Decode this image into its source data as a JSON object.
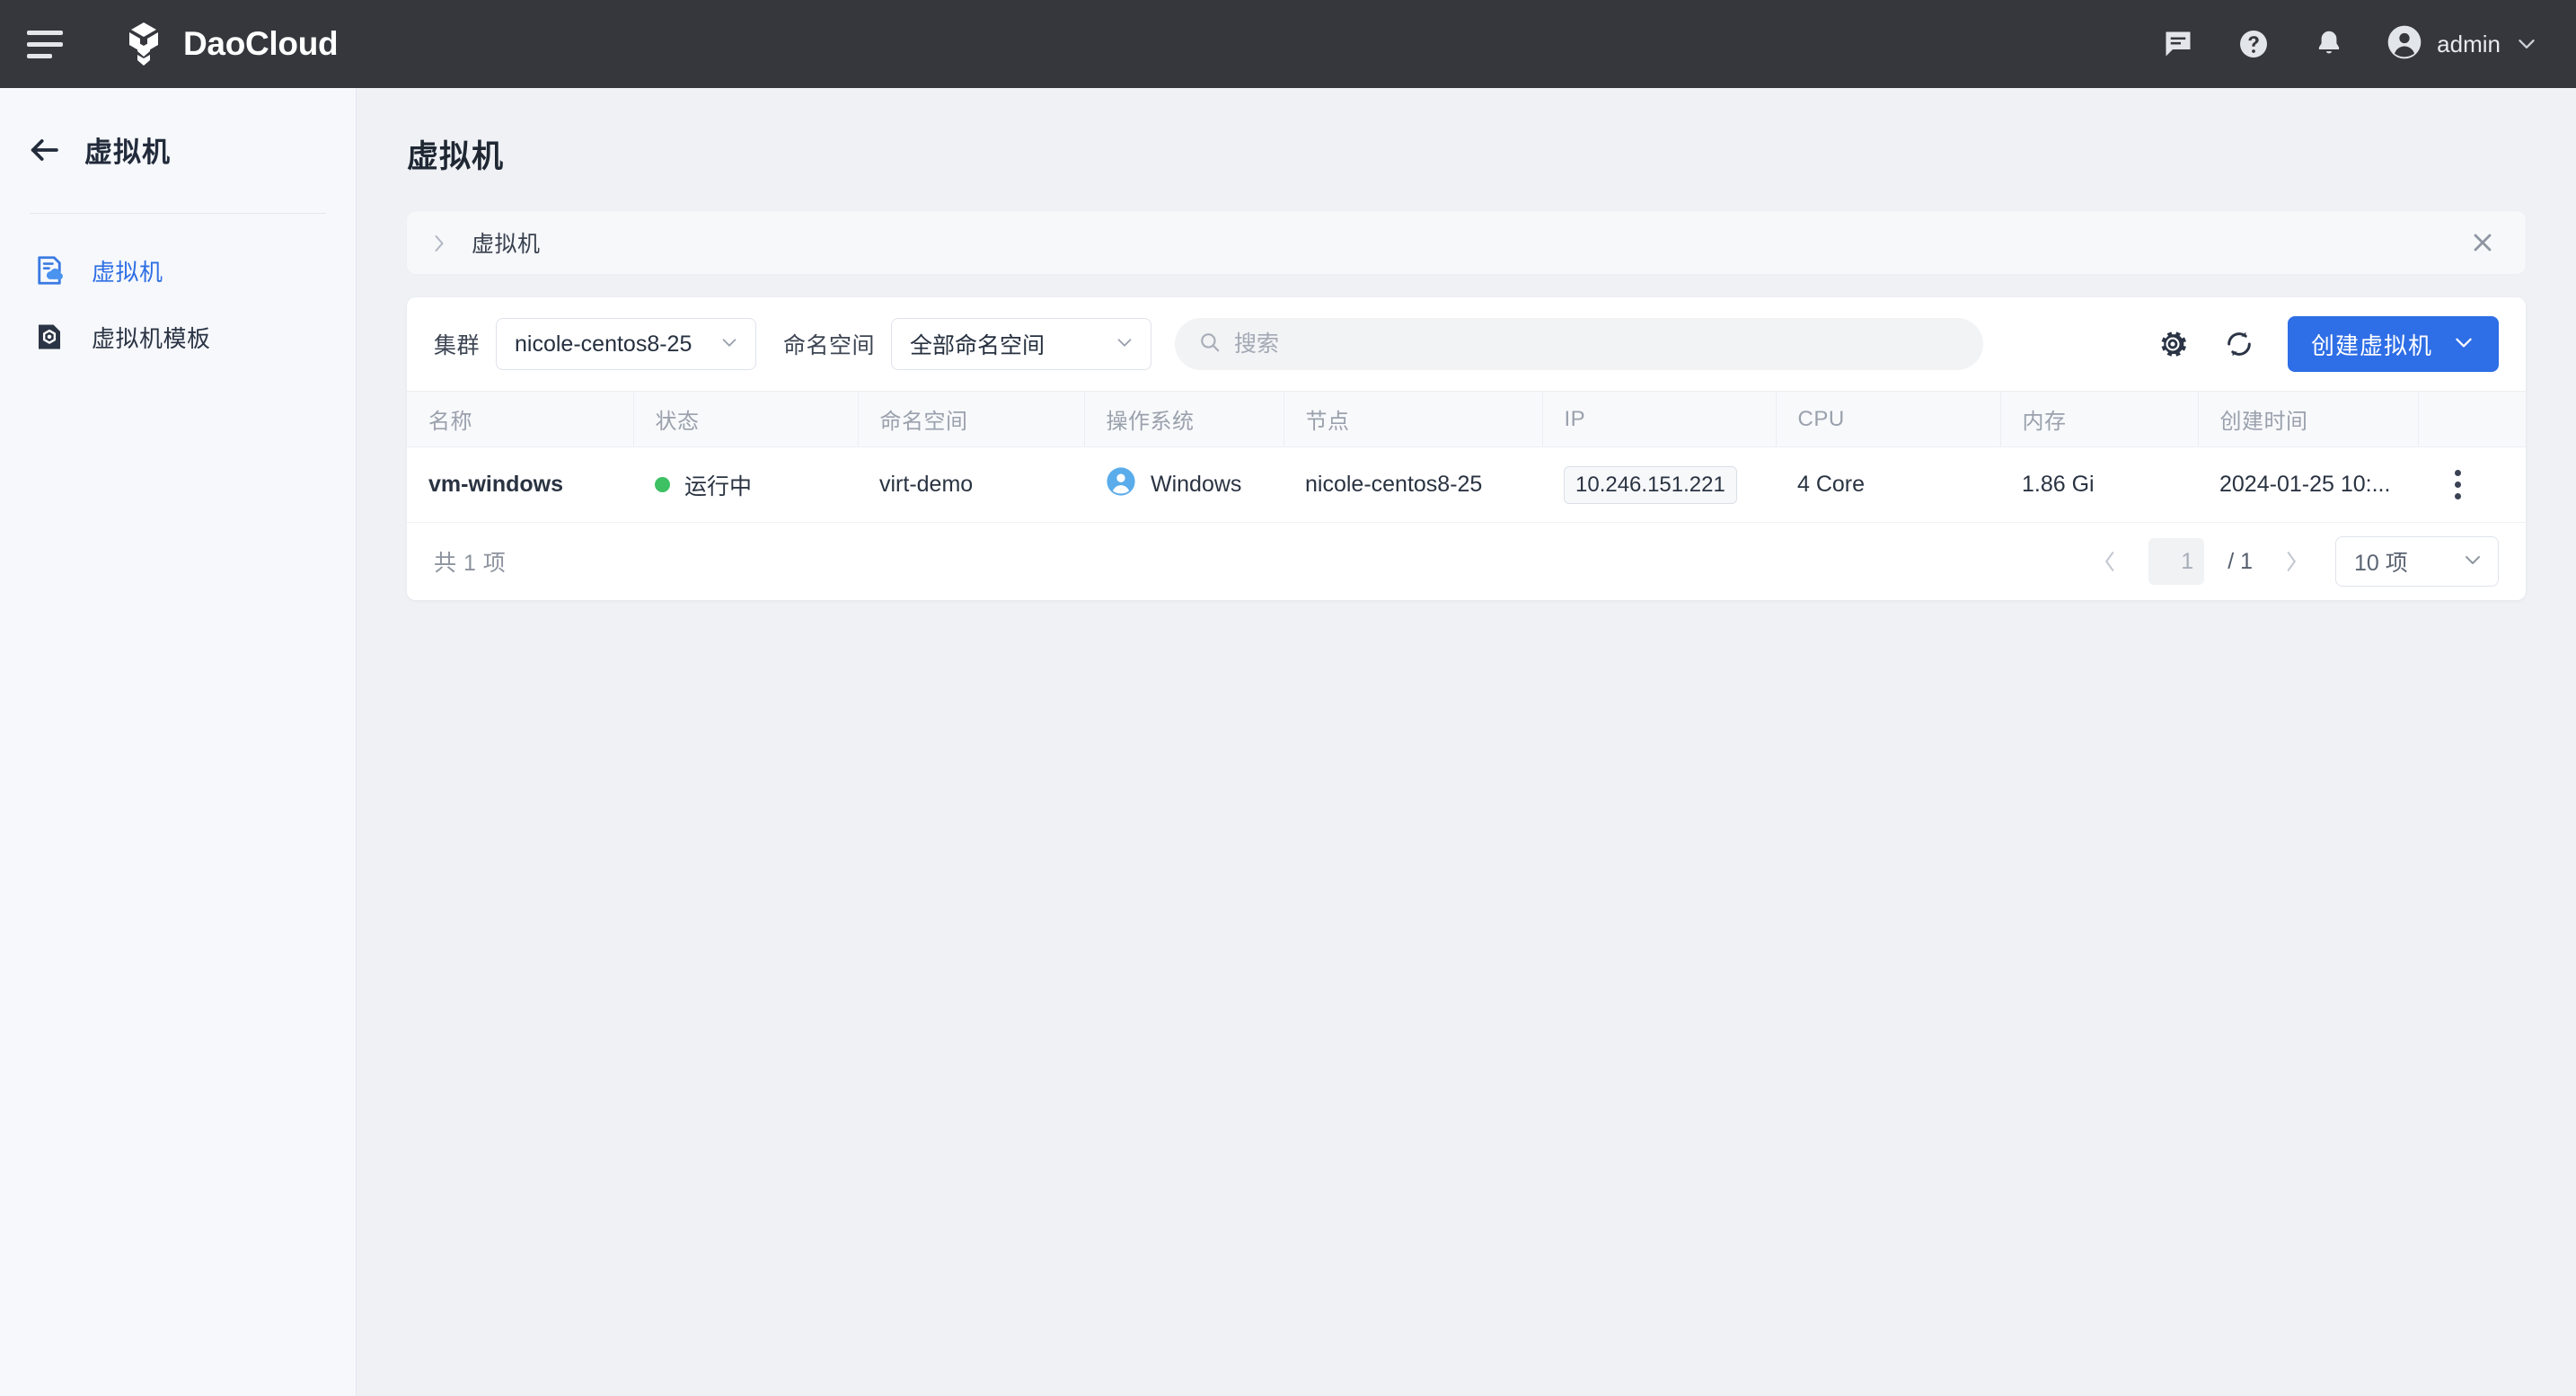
{
  "topbar": {
    "menu_icon": "hamburger-icon",
    "brand": "DaoCloud",
    "icons": [
      "message-icon",
      "help-icon",
      "bell-icon"
    ],
    "user": "admin"
  },
  "sidebar": {
    "back_icon": "back-arrow-icon",
    "title": "虚拟机",
    "items": [
      {
        "label": "虚拟机",
        "icon": "vm-icon",
        "active": true
      },
      {
        "label": "虚拟机模板",
        "icon": "vm-template-icon",
        "active": false
      }
    ]
  },
  "main": {
    "page_title": "虚拟机",
    "breadcrumb": {
      "text": "虚拟机",
      "expand_icon": "chevron-right-icon",
      "close_icon": "close-icon"
    },
    "toolbar": {
      "cluster_label": "集群",
      "cluster_value": "nicole-centos8-25",
      "namespace_label": "命名空间",
      "namespace_value": "全部命名空间",
      "search_placeholder": "搜索",
      "search_value": "",
      "settings_icon": "gear-icon",
      "refresh_icon": "refresh-icon",
      "create_button": "创建虚拟机"
    },
    "table": {
      "columns": [
        "名称",
        "状态",
        "命名空间",
        "操作系统",
        "节点",
        "IP",
        "CPU",
        "内存",
        "创建时间",
        ""
      ],
      "rows": [
        {
          "name": "vm-windows",
          "status": "运行中",
          "status_color": "#3dc163",
          "namespace": "virt-demo",
          "os": "Windows",
          "os_icon": "windows-user-icon",
          "node": "nicole-centos8-25",
          "ip": "10.246.151.221",
          "cpu": "4 Core",
          "memory": "1.86 Gi",
          "created_at": "2024-01-25 10:...",
          "actions_icon": "kebab-menu-icon"
        }
      ]
    },
    "pagination": {
      "total_text": "共 1 项",
      "prev_icon": "chevron-left-icon",
      "next_icon": "chevron-right-icon",
      "current_page": "1",
      "page_separator": "/ 1",
      "page_size": "10 项"
    }
  },
  "colors": {
    "header_bg": "#35373d",
    "accent": "#2e6ee6",
    "sidebar_bg": "#f6f8fb",
    "page_bg": "#eff1f5",
    "status_running": "#3dc163"
  }
}
